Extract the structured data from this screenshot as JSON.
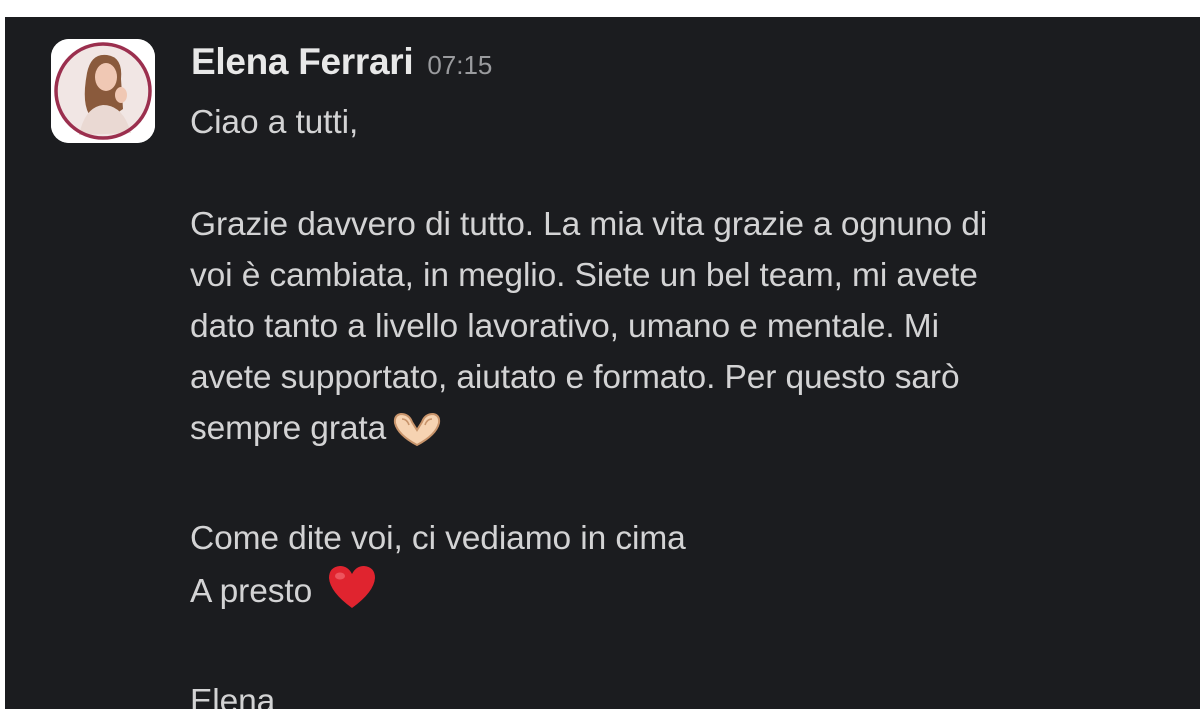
{
  "message": {
    "author": "Elena Ferrari",
    "time": "07:15",
    "lines": {
      "greeting": "Ciao a tutti,",
      "p1_l1": "Grazie davvero di tutto. La mia vita grazie a ognuno di",
      "p1_l2": "voi è cambiata, in meglio. Siete un bel team, mi avete",
      "p1_l3": "dato tanto a livello lavorativo, umano e mentale. Mi",
      "p1_l4": "avete supportato, aiutato e formato. Per questo sarò",
      "p1_l5": "sempre grata",
      "p2_l1": "Come dite voi, ci vediamo in cima",
      "p2_l2": "A presto",
      "signature": "Elena"
    },
    "emojis": {
      "heart_hands": "heart-hands-icon",
      "red_heart": "red-heart-icon"
    }
  },
  "colors": {
    "background": "#1b1c1f",
    "text": "#d3d3d4",
    "author": "#e8e8e8",
    "timestamp": "#9a9b9e",
    "avatar_ring": "#9b2f4e",
    "heart": "#e0242f"
  }
}
